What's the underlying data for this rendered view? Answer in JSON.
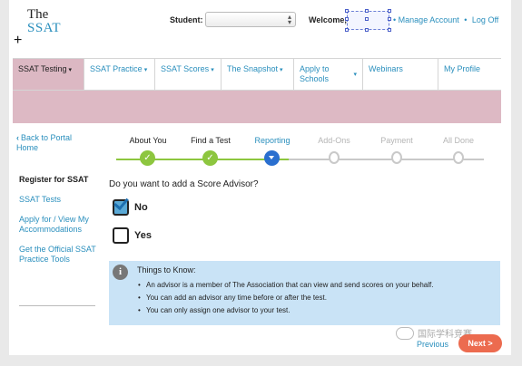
{
  "header": {
    "logo_the": "The",
    "logo_ssat": "SSAT",
    "plus_glyph": "+",
    "student_label": "Student:",
    "welcome_label": "Welcome,",
    "manage_account": "Manage Account",
    "log_off": "Log Off",
    "link_separator": "•"
  },
  "nav": {
    "items": [
      {
        "label": "SSAT Testing",
        "caret": "▾",
        "active": true
      },
      {
        "label": "SSAT Practice",
        "caret": "▾"
      },
      {
        "label": "SSAT Scores",
        "caret": "▾"
      },
      {
        "label": "The Snapshot",
        "caret": "▾"
      },
      {
        "label": "Apply to Schools",
        "caret": "▾"
      },
      {
        "label": "Webinars",
        "caret": ""
      },
      {
        "label": "My Profile",
        "caret": ""
      }
    ]
  },
  "sidebar": {
    "back_link": "Back to Portal Home",
    "back_icon": "‹",
    "items": [
      {
        "label": "Register for SSAT"
      },
      {
        "label": "SSAT Tests"
      },
      {
        "label": "Apply for / View My Accommodations"
      },
      {
        "label": "Get the Official SSAT Practice Tools"
      }
    ]
  },
  "steps": [
    {
      "label": "About You",
      "state": "done",
      "icon": "✓"
    },
    {
      "label": "Find a Test",
      "state": "done",
      "icon": "✓"
    },
    {
      "label": "Reporting",
      "state": "current",
      "icon": ""
    },
    {
      "label": "Add-Ons",
      "state": "future",
      "icon": ""
    },
    {
      "label": "Payment",
      "state": "future",
      "icon": ""
    },
    {
      "label": "All Done",
      "state": "future",
      "icon": ""
    }
  ],
  "question": {
    "text": "Do you want to add a Score Advisor?",
    "options": [
      {
        "label": "No",
        "checked": true
      },
      {
        "label": "Yes",
        "checked": false
      }
    ]
  },
  "info": {
    "icon": "i",
    "title": "Things to Know:",
    "items": [
      "An advisor is a member of The Association that can view and send scores on your behalf.",
      "You can add an advisor any time before or after the test.",
      "You can only assign one advisor to your test."
    ]
  },
  "footer": {
    "watermark": "国际学科竞赛",
    "previous": "Previous",
    "next": "Next >"
  },
  "colors": {
    "brand_blue": "#2a8fbd",
    "banner_pink": "#ddb9c4",
    "step_done": "#8dc63f",
    "step_current": "#2a6fcf",
    "info_bg": "#c9e3f6",
    "next_button": "#ec6b4f"
  }
}
